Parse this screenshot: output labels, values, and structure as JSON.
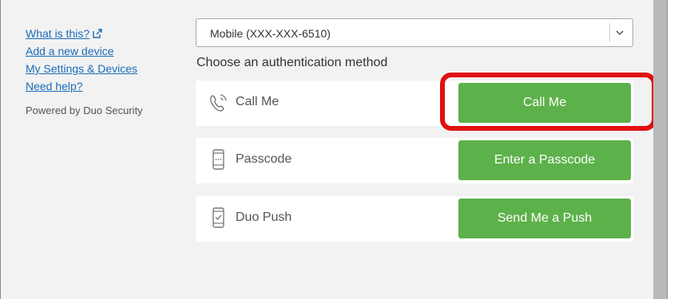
{
  "sidebar": {
    "links": [
      {
        "label": "What is this?"
      },
      {
        "label": "Add a new device"
      },
      {
        "label": "My Settings & Devices"
      },
      {
        "label": "Need help?"
      }
    ],
    "powered_by": "Powered by Duo Security"
  },
  "device": {
    "selected": "Mobile (XXX-XXX-6510)"
  },
  "auth": {
    "heading": "Choose an authentication method",
    "methods": [
      {
        "label": "Call Me",
        "button": "Call Me",
        "icon": "phone-call-icon"
      },
      {
        "label": "Passcode",
        "button": "Enter a Passcode",
        "icon": "passcode-phone-icon"
      },
      {
        "label": "Duo Push",
        "button": "Send Me a Push",
        "icon": "push-phone-icon"
      }
    ]
  },
  "colors": {
    "link": "#1a6bb8",
    "button": "#5db14a",
    "highlight": "#e01010"
  }
}
